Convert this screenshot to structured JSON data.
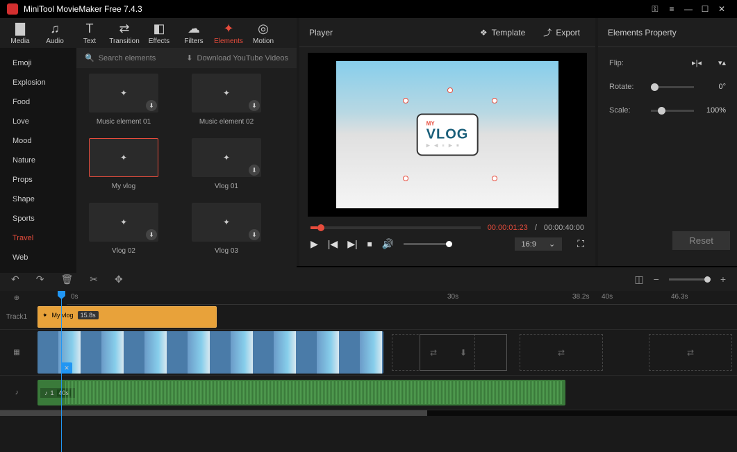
{
  "app": {
    "title": "MiniTool MovieMaker Free 7.4.3"
  },
  "toolbar": [
    {
      "label": "Media",
      "icon": "folder-icon",
      "glyph": "▇"
    },
    {
      "label": "Audio",
      "icon": "music-icon",
      "glyph": "♫"
    },
    {
      "label": "Text",
      "icon": "text-icon",
      "glyph": "T"
    },
    {
      "label": "Transition",
      "icon": "transition-icon",
      "glyph": "⇄"
    },
    {
      "label": "Effects",
      "icon": "effects-icon",
      "glyph": "◧"
    },
    {
      "label": "Filters",
      "icon": "filters-icon",
      "glyph": "☁"
    },
    {
      "label": "Elements",
      "icon": "elements-icon",
      "glyph": "✦",
      "active": true
    },
    {
      "label": "Motion",
      "icon": "motion-icon",
      "glyph": "◎"
    }
  ],
  "sidebar": {
    "items": [
      "Emoji",
      "Explosion",
      "Food",
      "Love",
      "Mood",
      "Nature",
      "Props",
      "Shape",
      "Sports",
      "Travel",
      "Web"
    ],
    "active": "Travel"
  },
  "search": {
    "placeholder": "Search elements",
    "download_label": "Download YouTube Videos"
  },
  "elements_grid": [
    {
      "label": "Music element 01",
      "dl": true
    },
    {
      "label": "Music element 02",
      "dl": true
    },
    {
      "label": "My vlog",
      "selected": true,
      "dl": false
    },
    {
      "label": "Vlog 01",
      "dl": true
    },
    {
      "label": "Vlog 02",
      "dl": true
    },
    {
      "label": "Vlog 03",
      "dl": true
    }
  ],
  "player": {
    "title": "Player",
    "template_label": "Template",
    "export_label": "Export",
    "time_current": "00:00:01:23",
    "time_total": "00:00:40:00",
    "aspect": "16:9",
    "overlay": "VLOG",
    "overlay_small": "MY"
  },
  "properties": {
    "title": "Elements Property",
    "flip_label": "Flip:",
    "rotate_label": "Rotate:",
    "rotate_value": "0°",
    "scale_label": "Scale:",
    "scale_value": "100%",
    "reset_label": "Reset"
  },
  "timeline": {
    "ruler": [
      {
        "label": "0s",
        "pos": 6
      },
      {
        "label": "30s",
        "pos": 548
      },
      {
        "label": "38.2s",
        "pos": 728
      },
      {
        "label": "40s",
        "pos": 770
      },
      {
        "label": "46.3s",
        "pos": 870
      }
    ],
    "track1_label": "Track1",
    "element_clip": {
      "name": "My vlog",
      "duration": "15.8s"
    },
    "audio_clip": {
      "count": "1",
      "duration": "40s"
    }
  }
}
